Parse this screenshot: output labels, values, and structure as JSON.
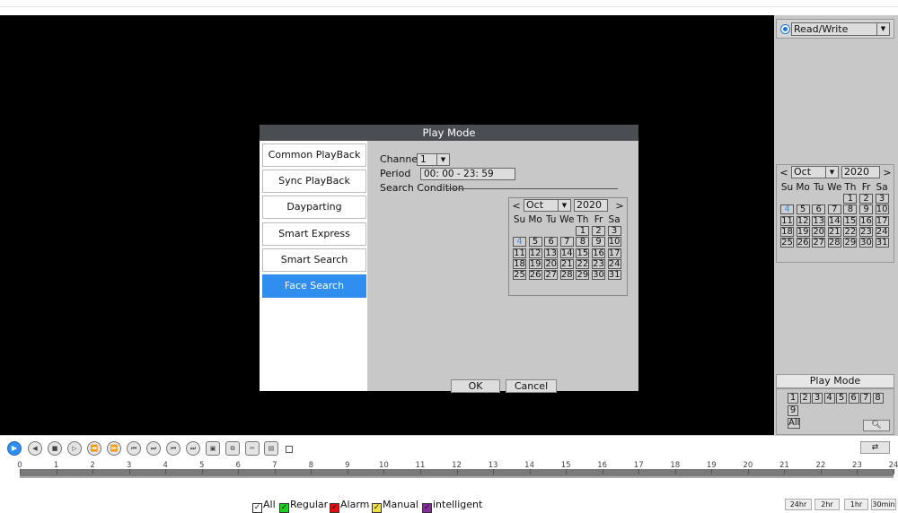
{
  "right_panel": {
    "mode_select": "Read/Write",
    "calendar": {
      "month": "Oct",
      "year": "2020",
      "dow": [
        "Su",
        "Mo",
        "Tu",
        "We",
        "Th",
        "Fr",
        "Sa"
      ],
      "days": [
        "1",
        "2",
        "3",
        "4",
        "5",
        "6",
        "7",
        "8",
        "9",
        "10",
        "11",
        "12",
        "13",
        "14",
        "15",
        "16",
        "17",
        "18",
        "19",
        "20",
        "21",
        "22",
        "23",
        "24",
        "25",
        "26",
        "27",
        "28",
        "29",
        "30",
        "31"
      ],
      "highlight_day": "4"
    },
    "play_mode_label": "Play Mode",
    "channels": [
      "1",
      "2",
      "3",
      "4",
      "5",
      "6",
      "7",
      "8",
      "9"
    ],
    "all_label": "All",
    "search_icon": "search-icon"
  },
  "dialog": {
    "title": "Play Mode",
    "menu": [
      "Common PlayBack",
      "Sync PlayBack",
      "Dayparting",
      "Smart Express",
      "Smart Search",
      "Face Search"
    ],
    "active_menu_index": 5,
    "channel_label": "Channel",
    "channel_value": "1",
    "period_label": "Period",
    "period_value": "00: 00    -  23: 59",
    "search_condition_label": "Search Condition",
    "calendar": {
      "month": "Oct",
      "year": "2020",
      "highlight_day": "4"
    },
    "ok_label": "OK",
    "cancel_label": "Cancel"
  },
  "toolbar": {
    "buttons": [
      "play",
      "reverse-play",
      "stop",
      "slow-play",
      "fast-backward",
      "fast-forward",
      "previous-frame",
      "next-frame",
      "previous-file",
      "next-file",
      "fullscreen",
      "clip",
      "cut",
      "save"
    ],
    "sync_icon": "sync-icon"
  },
  "timeline": {
    "ticks": [
      "0",
      "1",
      "2",
      "3",
      "4",
      "5",
      "6",
      "7",
      "8",
      "9",
      "10",
      "11",
      "12",
      "13",
      "14",
      "15",
      "16",
      "17",
      "18",
      "19",
      "20",
      "21",
      "22",
      "23",
      "24"
    ],
    "legend": [
      {
        "label": "All",
        "color": "#ffffff"
      },
      {
        "label": "Regular",
        "color": "#1fd11f"
      },
      {
        "label": "Alarm",
        "color": "#e01010"
      },
      {
        "label": "Manual",
        "color": "#f0e040"
      },
      {
        "label": "intelligent",
        "color": "#8a2c9c"
      }
    ],
    "zoom": [
      "24hr",
      "2hr",
      "1hr",
      "30min"
    ]
  }
}
